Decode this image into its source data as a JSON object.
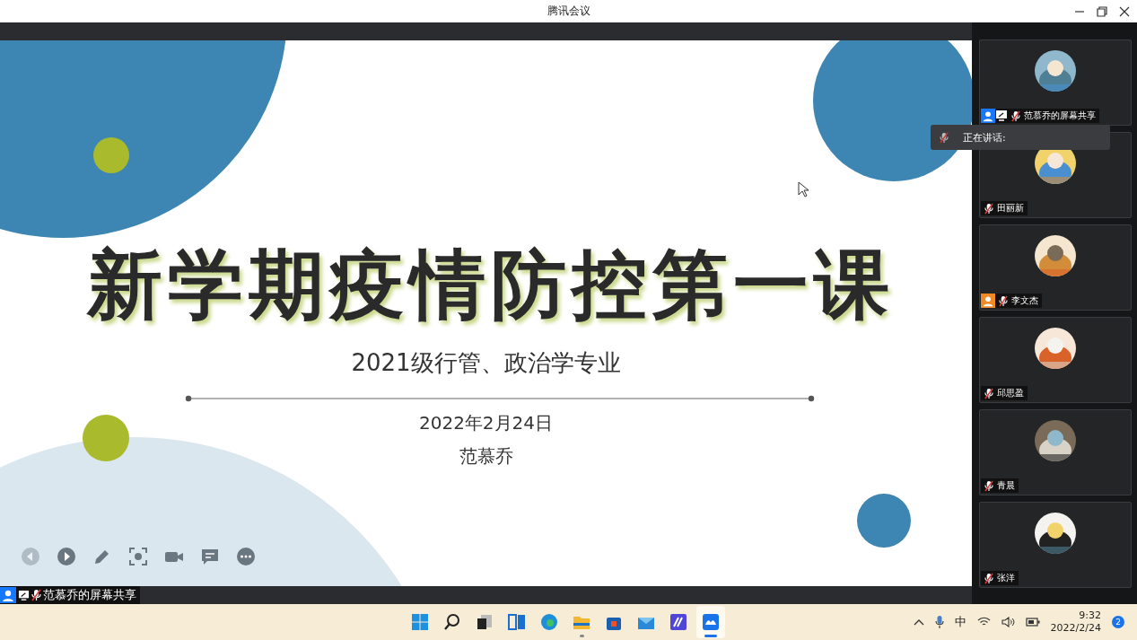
{
  "window": {
    "title": "腾讯会议"
  },
  "slide": {
    "title": "新学期疫情防控第一课",
    "subtitle": "2021级行管、政治学专业",
    "date": "2022年2月24日",
    "presenter": "范慕乔"
  },
  "slide_toolbar": [
    {
      "kind": "prev",
      "disabled": true
    },
    {
      "kind": "next",
      "disabled": false
    },
    {
      "kind": "pen",
      "disabled": false
    },
    {
      "kind": "focus",
      "disabled": false
    },
    {
      "kind": "camera",
      "disabled": false
    },
    {
      "kind": "chat",
      "disabled": false
    },
    {
      "kind": "more",
      "disabled": false
    }
  ],
  "share_label": {
    "text": "范慕乔的屏幕共享",
    "kind": "host",
    "sharing": true,
    "muted": true
  },
  "speaking_popup": {
    "label": "正在讲话:"
  },
  "participants": [
    {
      "name": "范慕乔的屏幕共享",
      "kind": "host",
      "sharing": true,
      "muted": true
    },
    {
      "name": "田丽新",
      "kind": "member",
      "sharing": false,
      "muted": true
    },
    {
      "name": "李文杰",
      "kind": "cohost",
      "sharing": false,
      "muted": true
    },
    {
      "name": "邱思盈",
      "kind": "member",
      "sharing": false,
      "muted": true
    },
    {
      "name": "青晨",
      "kind": "member",
      "sharing": false,
      "muted": true
    },
    {
      "name": "张洋",
      "kind": "member",
      "sharing": false,
      "muted": true
    }
  ],
  "taskbar": {
    "apps": [
      {
        "kind": "start",
        "selected": false,
        "running": false
      },
      {
        "kind": "search",
        "selected": false,
        "running": false
      },
      {
        "kind": "taskview",
        "selected": false,
        "running": false
      },
      {
        "kind": "widgets",
        "selected": false,
        "running": false
      },
      {
        "kind": "edge",
        "selected": false,
        "running": false
      },
      {
        "kind": "folder",
        "selected": false,
        "running": true
      },
      {
        "kind": "store",
        "selected": false,
        "running": false
      },
      {
        "kind": "mail",
        "selected": false,
        "running": false
      },
      {
        "kind": "pen-app",
        "selected": false,
        "running": false
      },
      {
        "kind": "meeting",
        "selected": true,
        "running": true
      }
    ],
    "ime": "中",
    "time": "9:32",
    "date": "2022/2/24",
    "notifications": "2"
  }
}
